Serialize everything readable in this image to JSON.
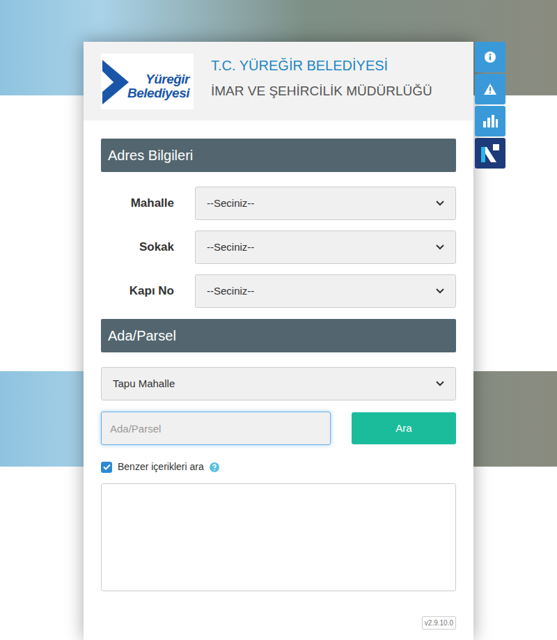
{
  "header": {
    "logo": {
      "line1": "Yüreğir",
      "line2": "Belediyesi"
    },
    "title": "T.C. YÜREĞİR BELEDİYESİ",
    "subtitle": "İMAR VE ŞEHİRCİLİK MÜDÜRLÜĞÜ"
  },
  "side_buttons": [
    {
      "kind": "info"
    },
    {
      "kind": "warning"
    },
    {
      "kind": "chart"
    },
    {
      "kind": "brand"
    }
  ],
  "address": {
    "title": "Adres Bilgileri",
    "fields": [
      {
        "label": "Mahalle",
        "value": "--Seciniz--"
      },
      {
        "label": "Sokak",
        "value": "--Seciniz--"
      },
      {
        "label": "Kapı No",
        "value": "--Seciniz--"
      }
    ]
  },
  "parcel": {
    "title": "Ada/Parsel",
    "district": {
      "value": "Tapu Mahalle"
    },
    "search": {
      "placeholder": "Ada/Parsel",
      "focused": true
    },
    "button": "Ara",
    "similar": {
      "label": "Benzer içerikleri ara",
      "checked": true
    },
    "results": []
  },
  "version": "v2.9.10.0"
}
